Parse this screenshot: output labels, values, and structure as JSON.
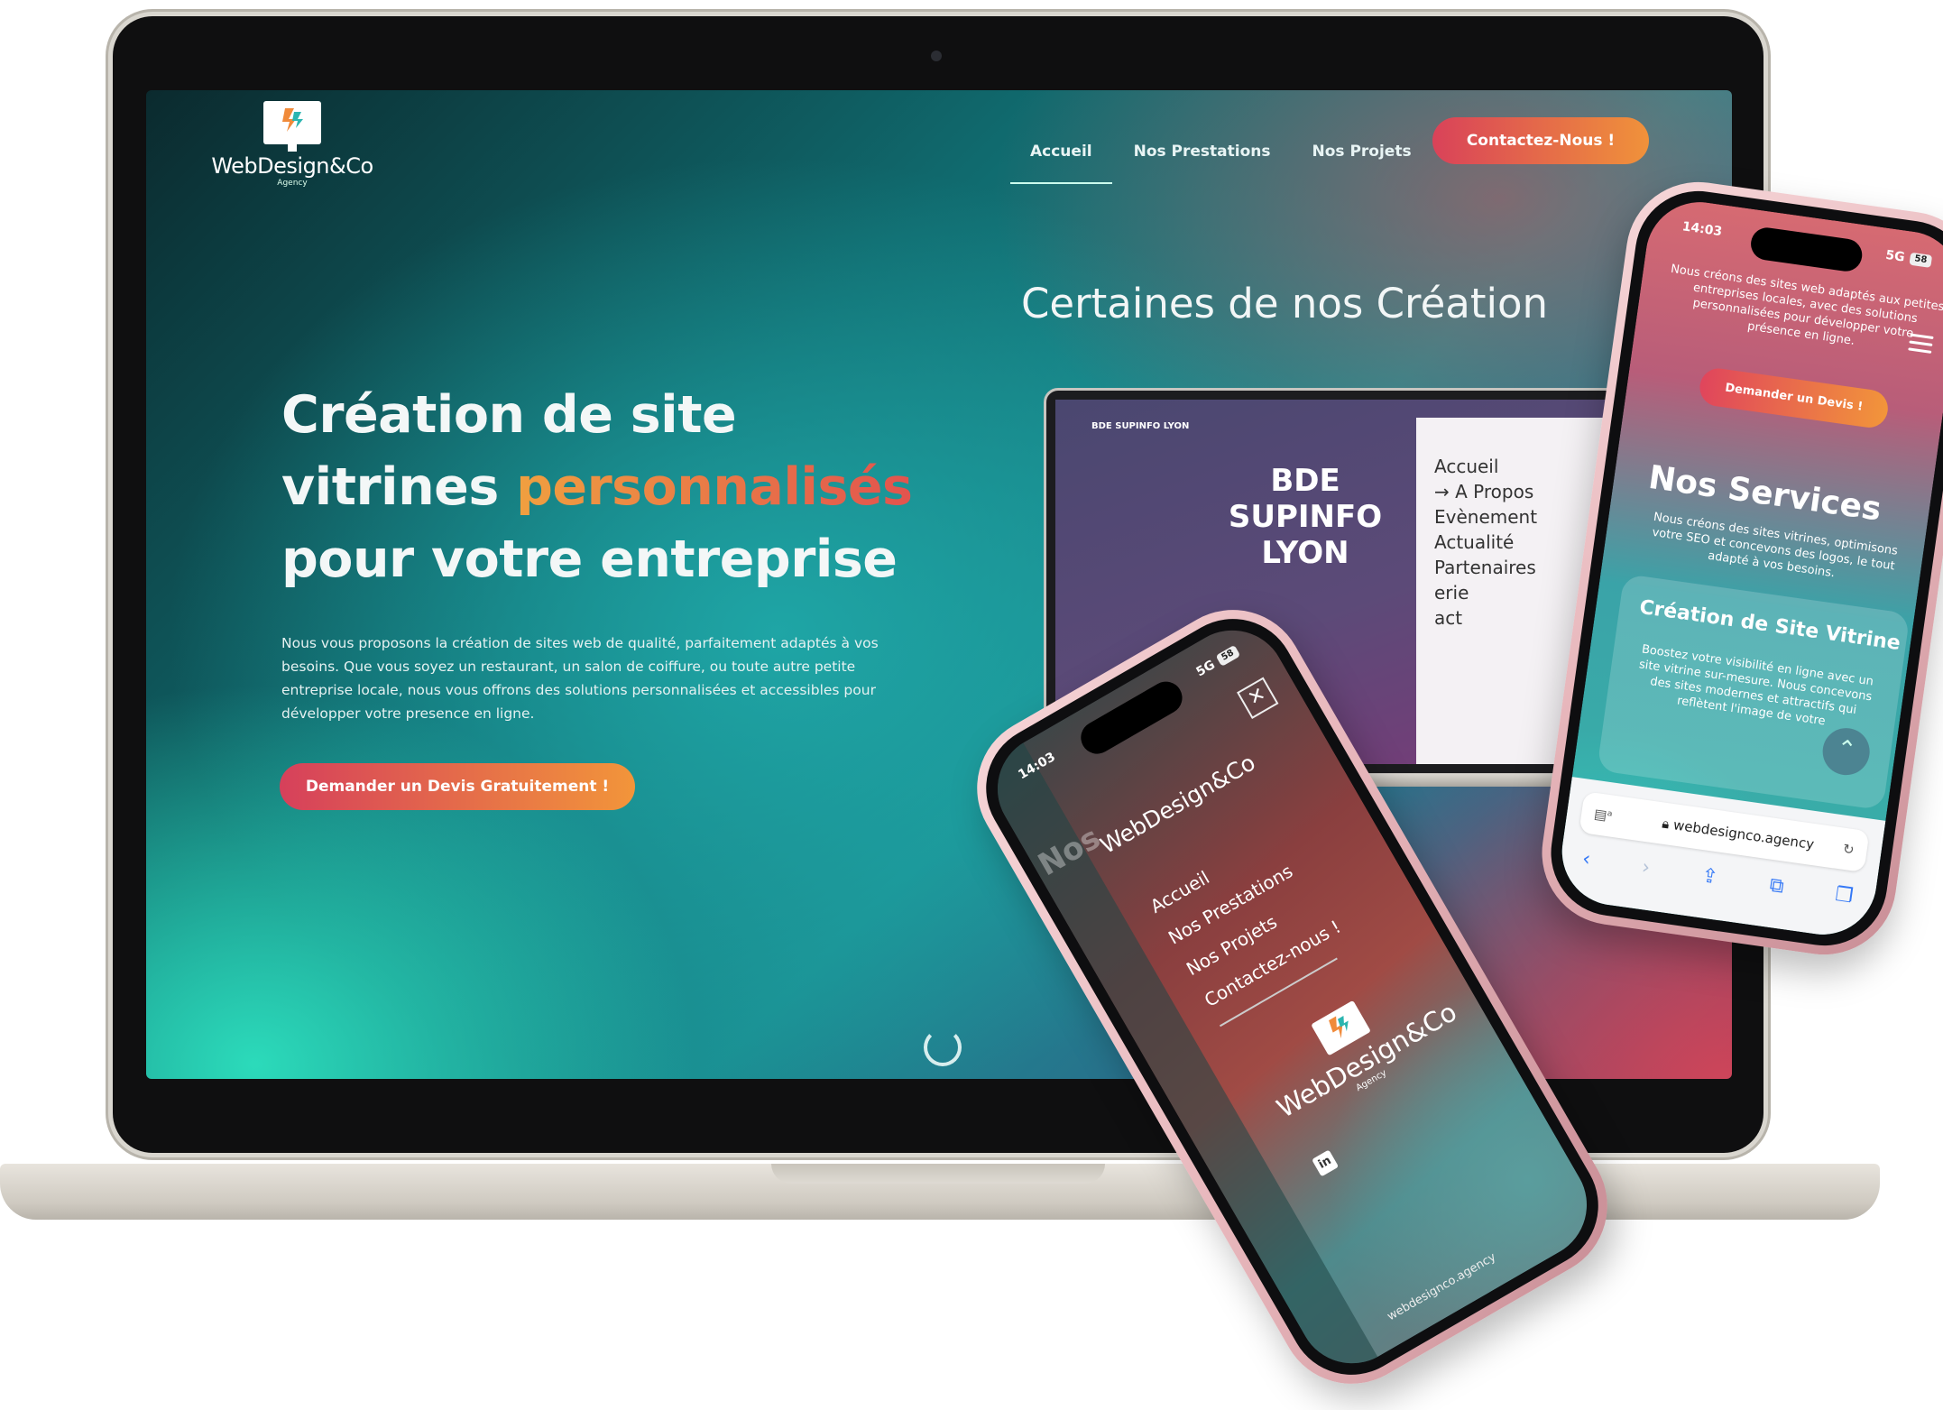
{
  "site": {
    "logo_text": "WebDesign&Co",
    "logo_sub": "Agency",
    "nav": [
      {
        "label": "Accueil",
        "active": true
      },
      {
        "label": "Nos Prestations",
        "active": false
      },
      {
        "label": "Nos Projets",
        "active": false
      }
    ],
    "contact_button": "Contactez-Nous !",
    "hero": {
      "line1": "Création de site",
      "line2_plain": "vitrines ",
      "line2_accent": "personnalisés",
      "line3": "pour votre entreprise",
      "description": "Nous vous proposons la création de sites web de qualité, parfaitement adaptés à vos besoins. Que vous soyez un restaurant, un salon de coiffure, ou toute autre petite entreprise locale, nous vous offrons des solutions personnalisées et accessibles pour développer votre presence en ligne.",
      "cta": "Demander un Devis Gratuitement !"
    },
    "creations_title": "Certaines de nos Création",
    "mockup": {
      "brand": "BDE SUPINFO LYON",
      "title": "BDE SUPINFO LYON",
      "menu": [
        "Accueil",
        "→ A Propos",
        "Evènement",
        "Actualité",
        "Partenaires",
        "erie",
        "act"
      ]
    }
  },
  "phone_right": {
    "time": "14:03",
    "signal": "5G",
    "battery": "58",
    "intro": "Nous créons des sites web adaptés aux petites entreprises locales, avec des solutions personnalisées pour développer votre présence en ligne.",
    "cta": "Demander un Devis !",
    "services_title": "Nos Services",
    "services_desc": "Nous créons des sites vitrines, optimisons votre SEO et concevons des logos, le tout adapté à vos besoins.",
    "card_title": "Création de Site Vitrine",
    "card_text": "Boostez votre visibilité en ligne avec un site vitrine sur-mesure. Nous concevons des sites modernes et attractifs qui reflètent l'image de votre",
    "url": "webdesignco.agency"
  },
  "phone_left": {
    "time": "14:03",
    "signal": "5G",
    "battery": "58",
    "brand": "WebDesign&Co",
    "menu": [
      "Accueil",
      "Nos Prestations",
      "Nos Projets",
      "Contactez-nous !"
    ],
    "logo_text": "WebDesign&Co",
    "logo_sub": "Agency",
    "linkedin": "in",
    "url": "webdesignco.agency",
    "peek": "Nos"
  },
  "colors": {
    "accent_start": "#d94259",
    "accent_end": "#f0923a",
    "teal": "#2fd0bc"
  }
}
